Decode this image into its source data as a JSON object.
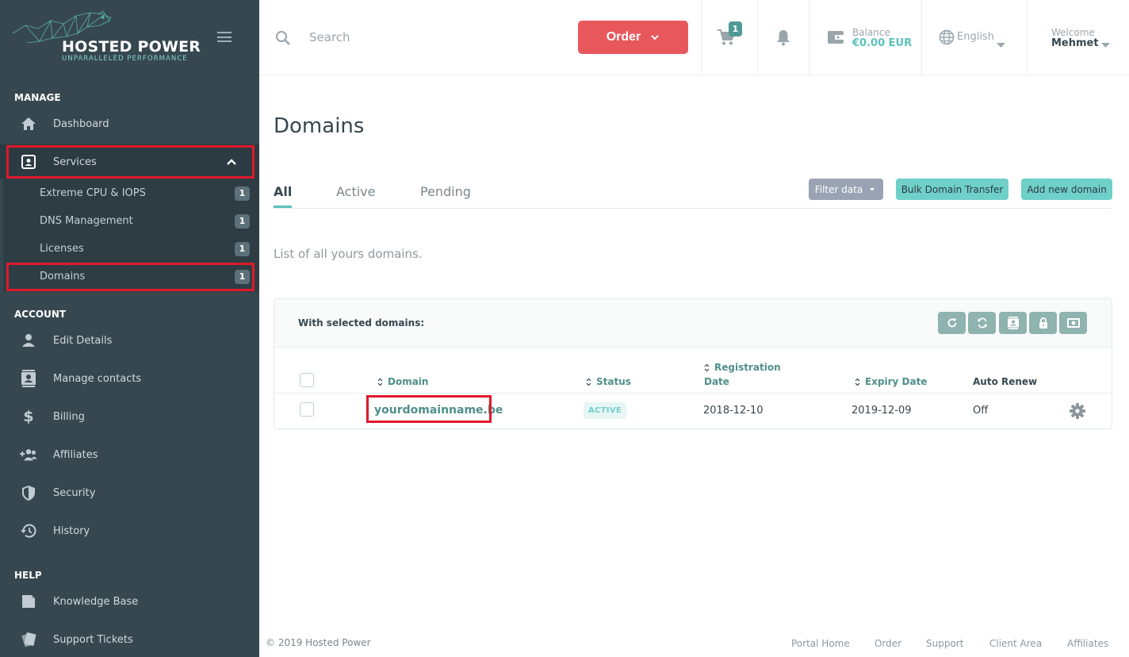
{
  "brand": {
    "name": "HOSTED POWER",
    "tagline": "UNPARALLELED PERFORMANCE",
    "accent": "#5bc3bb",
    "sidebar_bg": "#37474f",
    "order_color": "#e8575c"
  },
  "sidebar": {
    "manage_label": "MANAGE",
    "account_label": "ACCOUNT",
    "help_label": "HELP",
    "manage_items": [
      {
        "label": "Dashboard",
        "icon": "home-icon"
      },
      {
        "label": "Services",
        "icon": "id-badge-icon"
      }
    ],
    "services_sub": [
      {
        "label": "Extreme CPU & IOPS",
        "count": "1"
      },
      {
        "label": "DNS Management",
        "count": "1"
      },
      {
        "label": "Licenses",
        "count": "1"
      },
      {
        "label": "Domains",
        "count": "1"
      }
    ],
    "account_items": [
      {
        "label": "Edit Details",
        "icon": "user-icon"
      },
      {
        "label": "Manage contacts",
        "icon": "contacts-icon"
      },
      {
        "label": "Billing",
        "icon": "dollar-icon"
      },
      {
        "label": "Affiliates",
        "icon": "affiliates-icon"
      },
      {
        "label": "Security",
        "icon": "shield-icon"
      },
      {
        "label": "History",
        "icon": "history-icon"
      }
    ],
    "help_items": [
      {
        "label": "Knowledge Base",
        "icon": "book-icon"
      },
      {
        "label": "Support Tickets",
        "icon": "tickets-icon"
      }
    ]
  },
  "topbar": {
    "search_placeholder": "Search",
    "order_label": "Order",
    "cart_count": "1",
    "balance_label": "Balance",
    "balance_value": "€0.00 EUR",
    "language": "English",
    "welcome_label": "Welcome",
    "username": "Mehmet"
  },
  "main": {
    "title": "Domains",
    "tabs": [
      "All",
      "Active",
      "Pending"
    ],
    "filter_label": "Filter data",
    "bulk_transfer_label": "Bulk Domain Transfer",
    "add_domain_label": "Add new domain",
    "subtitle": "List of all yours domains.",
    "with_selected": "With selected domains:",
    "columns": {
      "domain": "Domain",
      "status": "Status",
      "registration_1": "Registration",
      "registration_2": "Date",
      "expiry": "Expiry Date",
      "auto_renew": "Auto Renew"
    },
    "rows": [
      {
        "domain": "yourdomainname.be",
        "status": "ACTIVE",
        "registration": "2018-12-10",
        "expiry": "2019-12-09",
        "auto_renew": "Off"
      }
    ]
  },
  "footer": {
    "copyright": "© 2019 Hosted Power",
    "links": [
      "Portal Home",
      "Order",
      "Support",
      "Client Area",
      "Affiliates"
    ]
  }
}
